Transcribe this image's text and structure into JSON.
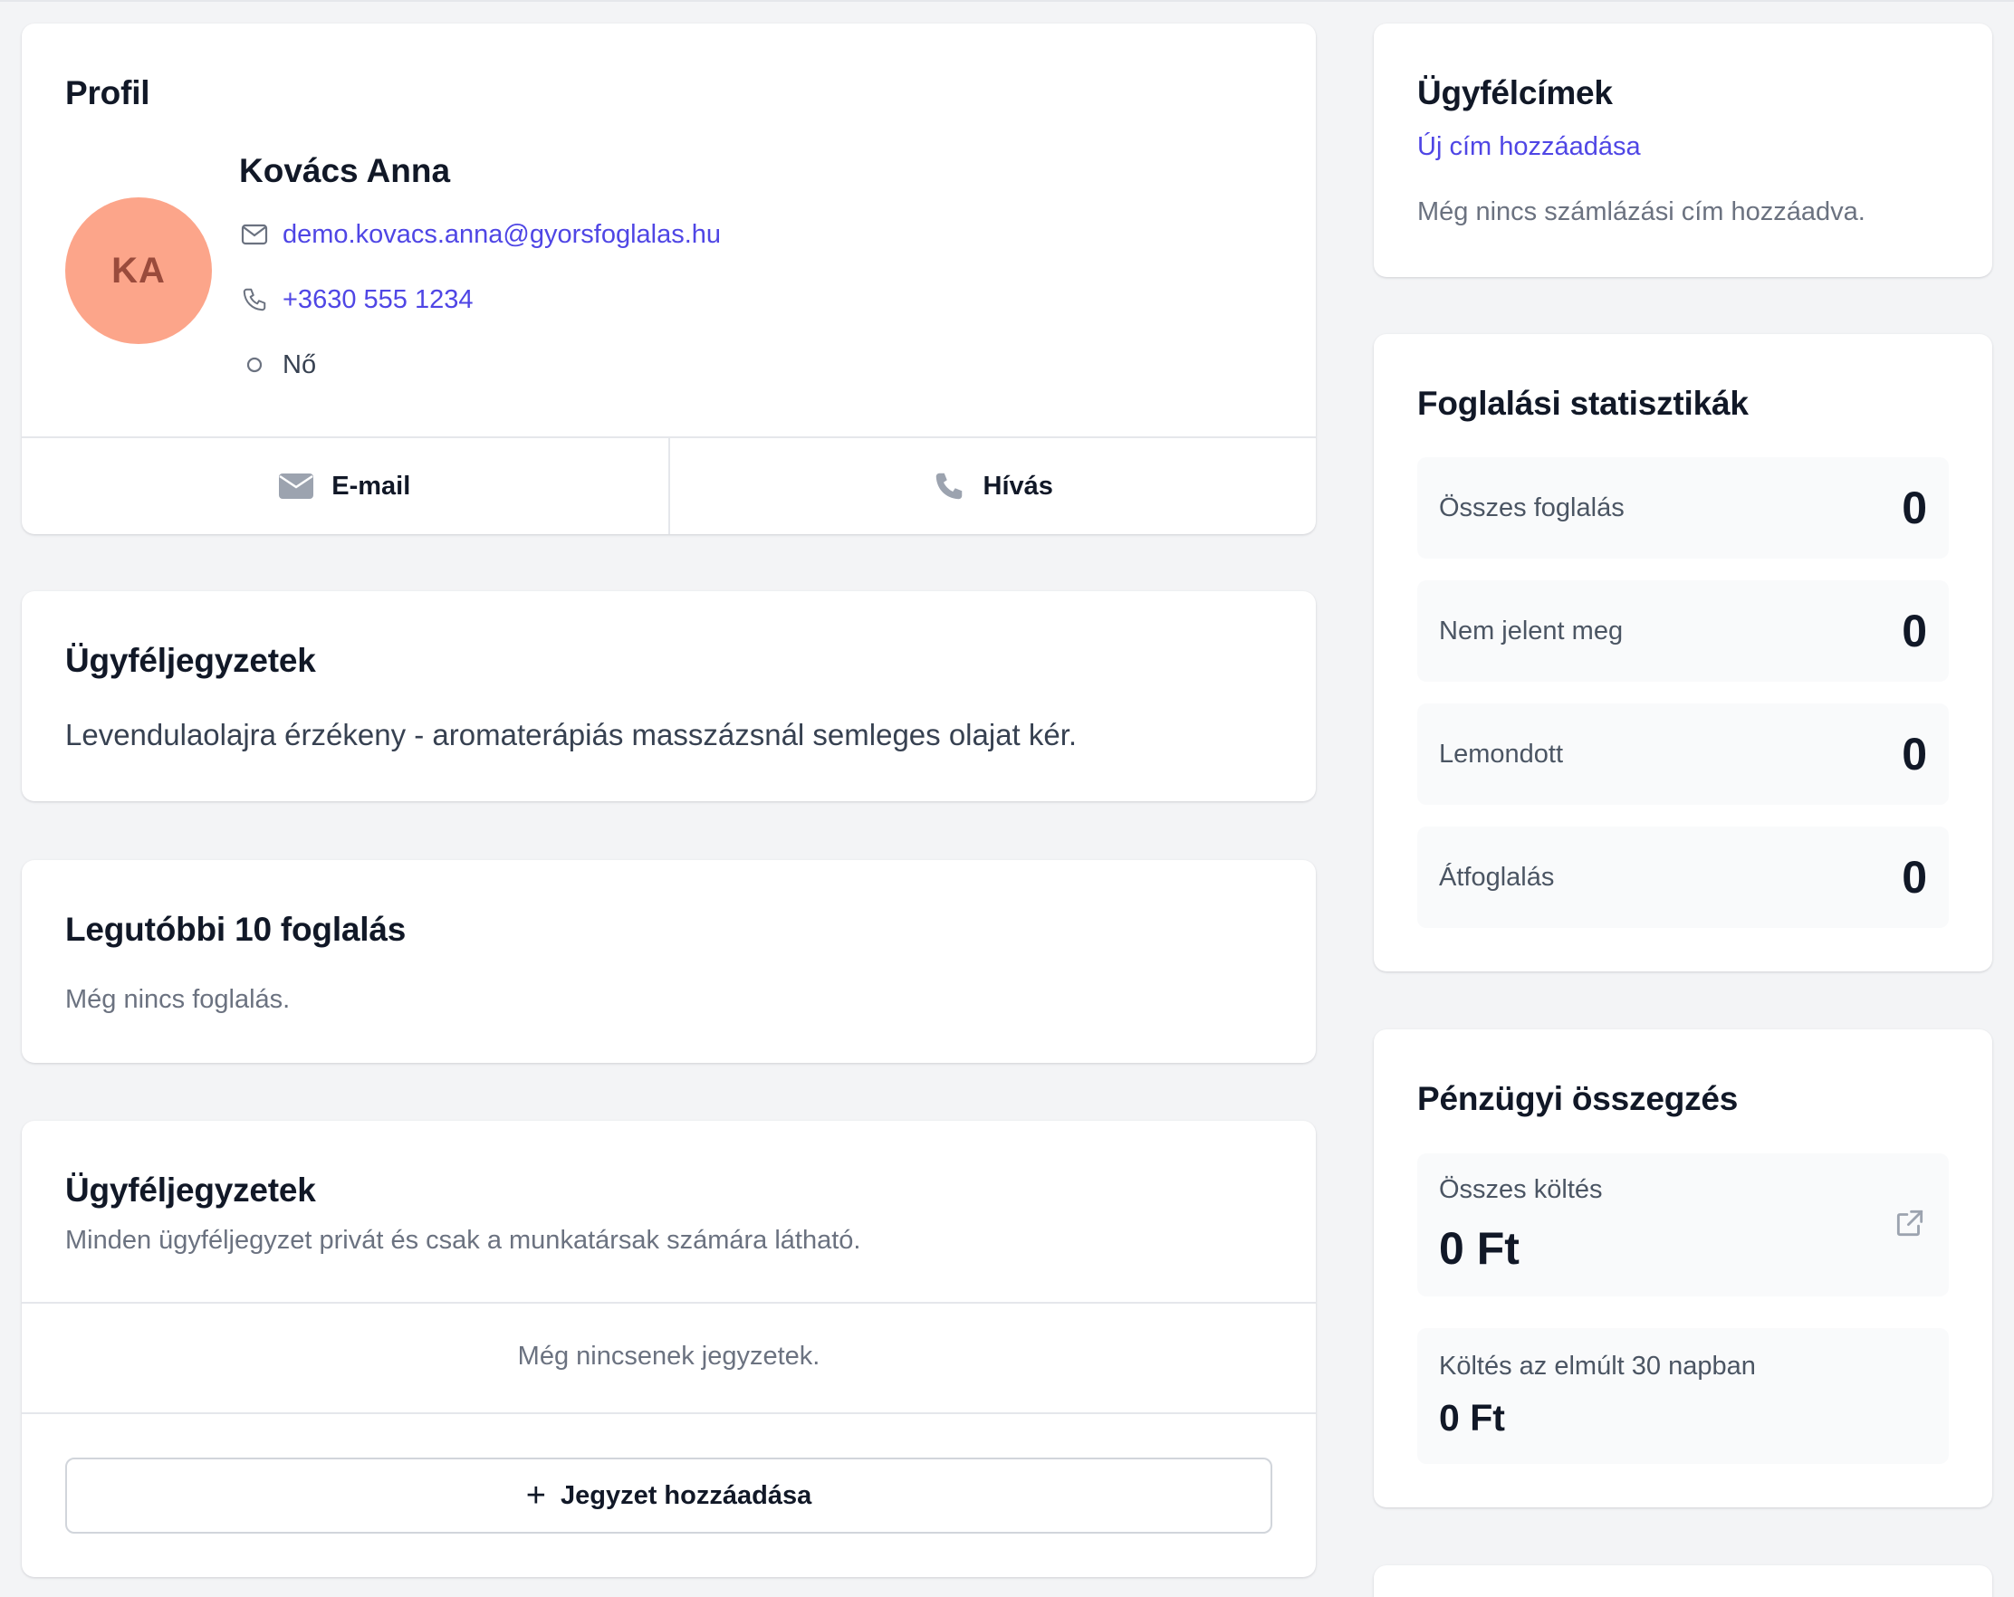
{
  "profile": {
    "title": "Profil",
    "avatar_initials": "KA",
    "avatar_color": "#fca58a",
    "name": "Kovács Anna",
    "email": "demo.kovacs.anna@gyorsfoglalas.hu",
    "phone": "+3630 555 1234",
    "gender": "Nő",
    "actions": {
      "email_label": "E-mail",
      "call_label": "Hívás"
    }
  },
  "client_notes": {
    "title": "Ügyféljegyzetek",
    "text": "Levendulaolajra érzékeny - aromaterápiás masszázsnál semleges olajat kér."
  },
  "recent_bookings": {
    "title": "Legutóbbi 10 foglalás",
    "empty_text": "Még nincs foglalás."
  },
  "notes_panel": {
    "title": "Ügyféljegyzetek",
    "subtitle": "Minden ügyféljegyzet privát és csak a munkatársak számára látható.",
    "empty_text": "Még nincsenek jegyzetek.",
    "add_button_label": "Jegyzet hozzáadása"
  },
  "addresses": {
    "title": "Ügyfélcímek",
    "add_link": "Új cím hozzáadása",
    "empty_text": "Még nincs számlázási cím hozzáadva."
  },
  "booking_stats": {
    "title": "Foglalási statisztikák",
    "items": [
      {
        "label": "Összes foglalás",
        "value": "0"
      },
      {
        "label": "Nem jelent meg",
        "value": "0"
      },
      {
        "label": "Lemondott",
        "value": "0"
      },
      {
        "label": "Átfoglalás",
        "value": "0"
      }
    ]
  },
  "financial_summary": {
    "title": "Pénzügyi összegzés",
    "total_label": "Összes költés",
    "total_value": "0 Ft",
    "last30_label": "Költés az elmúlt 30 napban",
    "last30_value": "0 Ft"
  },
  "colors": {
    "accent": "#4f46e5",
    "background": "#f3f4f6",
    "card": "#ffffff",
    "icon_gray": "#9ca3af"
  }
}
